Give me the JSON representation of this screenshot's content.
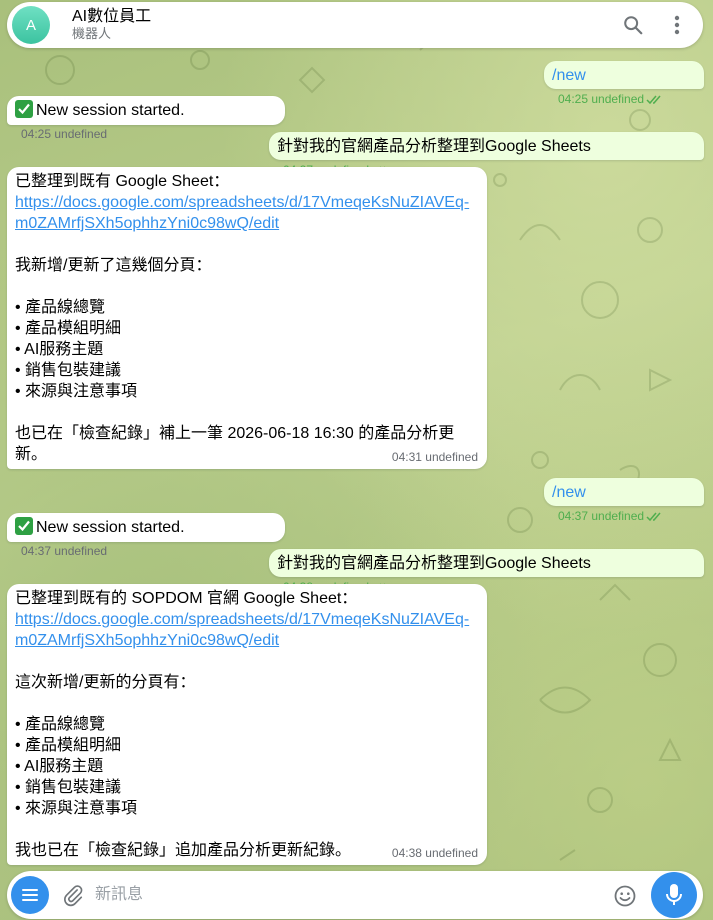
{
  "header": {
    "avatar_letter": "A",
    "title": "AI數位員工",
    "subtitle": "機器人"
  },
  "messages": [
    {
      "dir": "out",
      "text": "/new",
      "time": "04:25 undefined"
    },
    {
      "dir": "in",
      "text": "New session started.",
      "time": "04:25 undefined"
    },
    {
      "dir": "out",
      "text": "針對我的官網產品分析整理到Google Sheets",
      "time": "04:27 undefined"
    },
    {
      "dir": "in",
      "intro": "已整理到既有 Google Sheet：",
      "link_line1": "https://docs.google.com/spreadsheets/d/17VmeqeKsNuZIAVEq-",
      "link_line2": "m0ZAMrfjSXh5ophhzYni0c98wQ/edit",
      "heading": "我新增/更新了這幾個分頁：",
      "items": [
        "• 產品線總覽",
        "• 產品模組明細",
        "• AI服務主題",
        "• 銷售包裝建議",
        "• 來源與注意事項"
      ],
      "outro_line1": "也已在「檢查紀錄」補上一筆 2026-06-18 16:30 的產品分析更",
      "outro_line2": "新。",
      "time": "04:31 undefined"
    },
    {
      "dir": "out",
      "text": "/new",
      "time": "04:37 undefined"
    },
    {
      "dir": "in",
      "text": "New session started.",
      "time": "04:37 undefined"
    },
    {
      "dir": "out",
      "text": "針對我的官網產品分析整理到Google Sheets",
      "time": "04:38 undefined"
    },
    {
      "dir": "in",
      "intro": "已整理到既有的 SOPDOM 官網 Google Sheet：",
      "link_line1": "https://docs.google.com/spreadsheets/d/17VmeqeKsNuZIAVEq-",
      "link_line2": "m0ZAMrfjSXh5ophhzYni0c98wQ/edit",
      "heading": "這次新增/更新的分頁有：",
      "items": [
        "• 產品線總覽",
        "• 產品模組明細",
        "• AI服務主題",
        "• 銷售包裝建議",
        "• 來源與注意事項"
      ],
      "outro_line1": "我也已在「檢查紀錄」追加產品分析更新紀錄。",
      "time": "04:38 undefined"
    }
  ],
  "composer": {
    "placeholder": "新訊息"
  },
  "icons": {
    "header": [
      "search-icon",
      "more-vertical-icon"
    ],
    "composer": [
      "menu-icon",
      "paperclip-icon",
      "emoji-icon",
      "microphone-icon"
    ],
    "status": "double-check-icon",
    "session": "check-mark-box-icon"
  },
  "colors": {
    "accent": "#3390ec",
    "outgoing_bubble": "#eeffde",
    "read_check": "#4fae4e",
    "avatar": "#3cc3a0"
  }
}
